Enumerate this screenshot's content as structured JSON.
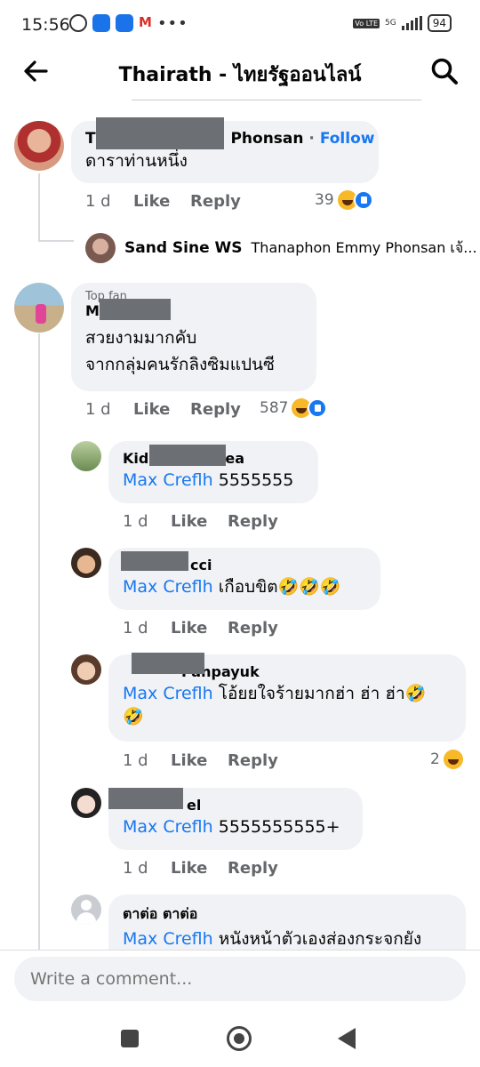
{
  "status_bar": {
    "time": "15:56",
    "icons": [
      "alarm-icon",
      "phone-icon",
      "messages-icon",
      "gmail-icon",
      "more-dots-icon"
    ],
    "volte": "Vo LTE",
    "network": "5G",
    "battery": "94"
  },
  "header": {
    "title": "Thairath - ไทยรัฐออนไลน์"
  },
  "comments": [
    {
      "name_start": "T",
      "name_end": "Phonsan",
      "separator": "·",
      "follow_label": "Follow",
      "text": "ดาราท่านหนึ่ง",
      "time": "1 d",
      "like_label": "Like",
      "reply_label": "Reply",
      "reaction_count": "39",
      "reactions": [
        "haha-icon",
        "like-icon"
      ],
      "reply_preview": {
        "name": "Sand Sine WS",
        "text": "Thanaphon Emmy Phonsan เจ้..."
      }
    },
    {
      "badge": "Top fan",
      "name": "Max Creflh",
      "text_line1": "สวยงามมากคับ",
      "text_line2": "จากกลุ่มคนรักลิงซิมแปนซี",
      "time": "1 d",
      "like_label": "Like",
      "reply_label": "Reply",
      "reaction_count": "587",
      "reactions": [
        "haha-icon",
        "like-icon"
      ],
      "replies": [
        {
          "name_start": "Kid",
          "name_end": "ea",
          "mention": "Max Creflh",
          "text": "5555555",
          "time": "1 d",
          "like_label": "Like",
          "reply_label": "Reply"
        },
        {
          "name_end": "cci",
          "mention": "Max Creflh",
          "text": "เกือบขิต🤣🤣🤣",
          "time": "1 d",
          "like_label": "Like",
          "reply_label": "Reply"
        },
        {
          "name_end": "Panpayuk",
          "mention": "Max Creflh",
          "text": "โอ้ยยใจร้ายมากฮ่า ฮ่า ฮ่า🤣",
          "text_line2": "🤣",
          "time": "1 d",
          "like_label": "Like",
          "reply_label": "Reply",
          "reaction_count": "2",
          "reactions": [
            "haha-icon"
          ]
        },
        {
          "name_end": "el",
          "mention": "Max Creflh",
          "text": "5555555555+",
          "time": "1 d",
          "like_label": "Like",
          "reply_label": "Reply"
        },
        {
          "name": "ตาต่อ ตาต่อ",
          "mention": "Max Creflh",
          "text": "หนังหน้าตัวเองส่องกระจกยัง"
        }
      ]
    }
  ],
  "composer": {
    "placeholder": "Write a comment..."
  },
  "colors": {
    "accent": "#1877f2",
    "bubble": "#f0f2f5",
    "meta": "#65676b"
  }
}
